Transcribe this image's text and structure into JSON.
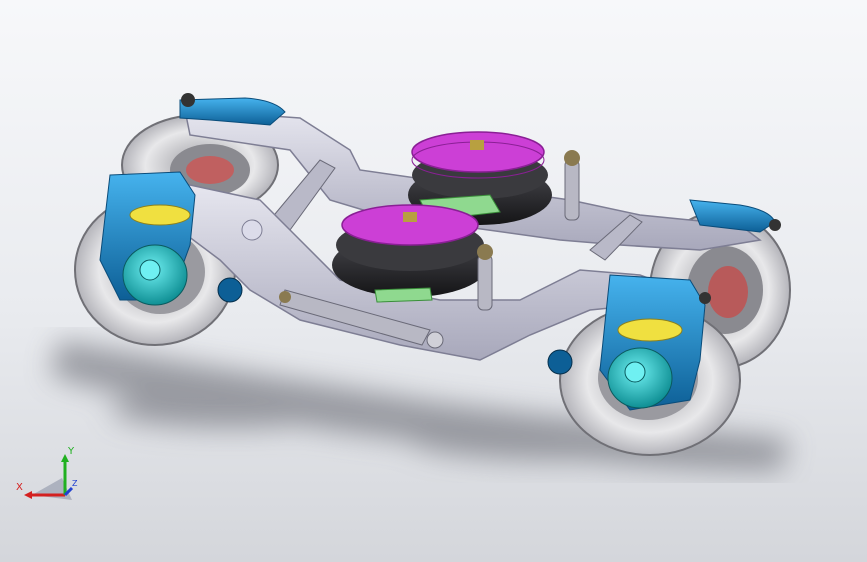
{
  "viewport": {
    "background_top": "#f7f8fa",
    "background_bottom": "#d4d6db"
  },
  "model": {
    "colors": {
      "frame": "#c9c9d6",
      "frame_shade": "#a6a6b8",
      "tire": "#e4e4e6",
      "tire_rim": "#8a8a90",
      "axlebox": "#1a8fd0",
      "axlebox_dark": "#0d5f96",
      "hub": "#18c4c8",
      "air_spring": "#cc3fd6",
      "rubber": "#2a2a2e",
      "plate_green": "#8fd98f",
      "damper": "#b8b8c4"
    }
  },
  "triad": {
    "x_label": "X",
    "y_label": "Y",
    "z_label": "Z",
    "x_color": "#d42020",
    "y_color": "#20b020",
    "z_color": "#2040d0"
  }
}
